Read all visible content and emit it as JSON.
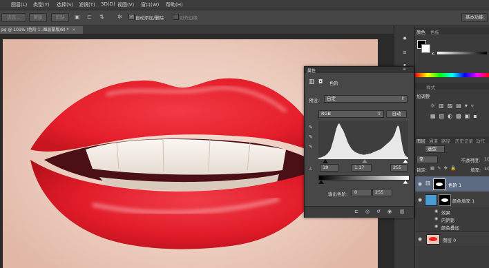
{
  "menu": [
    "图层(L)",
    "类型(Y)",
    "选择(S)",
    "滤镜(T)",
    "3D(D)",
    "视图(V)",
    "窗口(W)",
    "帮助(H)"
  ],
  "options": {
    "btn1": "选区…",
    "btn2": "蒙版",
    "btn3": "剪贴",
    "auto_add_erase": "自动添加/删除",
    "align_edges": "对齐边缘",
    "workspace": "基本功能"
  },
  "doc_tab": "pg @ 101% (色阶 1, 图层蒙版/8) *",
  "doc_tab_close": "×",
  "right_panels": {
    "color_tab": "颜色",
    "swatch_tab": "色板",
    "k_label": "K",
    "adjust_label": "加调整",
    "styles_tab": "样式",
    "layers_tabs": [
      "图层",
      "通道",
      "路径",
      "历史记录",
      "动作"
    ],
    "kind_select": "选型",
    "blend_mode": "常",
    "opacity_label": "不透明度:",
    "opacity_value": "10",
    "lock_label": "锁定:",
    "fill_label": "填充:",
    "fill_value": "10",
    "layers": [
      {
        "name": "色阶 1"
      },
      {
        "name": "颜色填充 1"
      },
      {
        "name": "效果"
      },
      {
        "name": "内阴影"
      },
      {
        "name": "颜色叠加"
      },
      {
        "name": "图层 0"
      }
    ]
  },
  "properties": {
    "title": "属性",
    "header": "色阶",
    "preset_label": "预设:",
    "preset_value": "自定",
    "channel": "RGB",
    "auto": "自动",
    "input_black": "19",
    "input_gamma": "1.17",
    "input_white": "255",
    "output_label": "输出色阶:",
    "output_black": "0",
    "output_white": "255"
  },
  "colors": {
    "lip": "#e8222e",
    "panel_bg": "#474747",
    "selected_layer": "#5b6a80"
  },
  "histogram": [
    2,
    3,
    3,
    4,
    5,
    6,
    8,
    10,
    13,
    16,
    22,
    30,
    38,
    48,
    56,
    62,
    64,
    60,
    55,
    52,
    46,
    40,
    34,
    28,
    24,
    20,
    17,
    15,
    13,
    12,
    11,
    10,
    9,
    9,
    8,
    8,
    8,
    9,
    9,
    10,
    10,
    11,
    12,
    13,
    14,
    15,
    16,
    17,
    18,
    20,
    22,
    24,
    26,
    28,
    30,
    32,
    35,
    38,
    42,
    48,
    55,
    60,
    58,
    45,
    30,
    18,
    10,
    6,
    4,
    3
  ]
}
